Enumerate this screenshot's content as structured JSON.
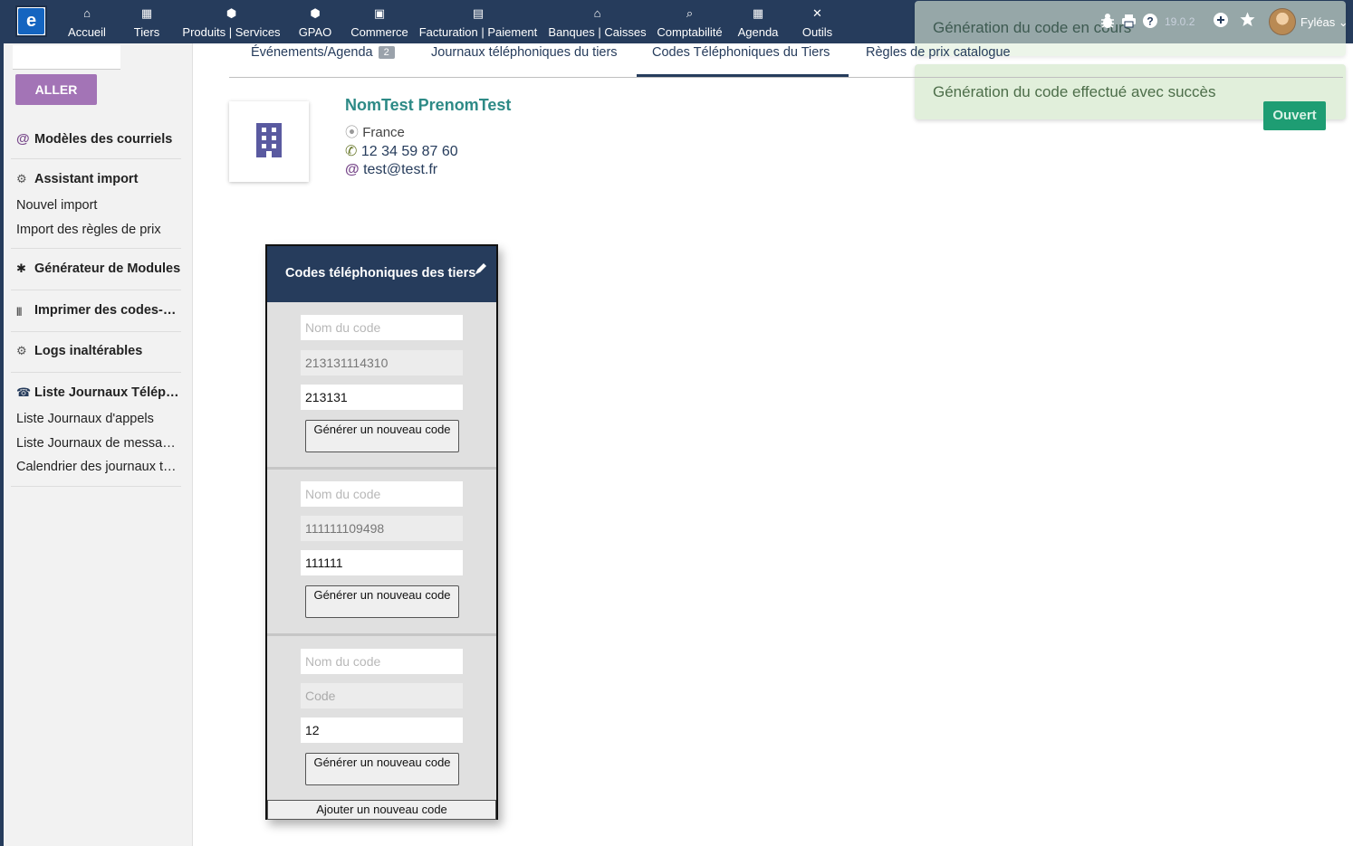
{
  "topbar": {
    "menu": [
      {
        "icon": "home-icon",
        "glyph": "⌂",
        "label": "Accueil"
      },
      {
        "icon": "building-icon",
        "glyph": "▦",
        "label": "Tiers"
      },
      {
        "icon": "cube-icon",
        "glyph": "⬢",
        "label": "Produits | Services"
      },
      {
        "icon": "cubes-icon",
        "glyph": "⬢",
        "label": "GPAO"
      },
      {
        "icon": "suitcase-icon",
        "glyph": "▣",
        "label": "Commerce"
      },
      {
        "icon": "file-invoice-icon",
        "glyph": "▤",
        "label": "Facturation | Paiement"
      },
      {
        "icon": "bank-icon",
        "glyph": "⌂",
        "label": "Banques | Caisses"
      },
      {
        "icon": "search-dollar-icon",
        "glyph": "⌕",
        "label": "Comptabilité"
      },
      {
        "icon": "calendar-icon",
        "glyph": "▦",
        "label": "Agenda"
      },
      {
        "icon": "tools-icon",
        "glyph": "✕",
        "label": "Outils"
      }
    ],
    "version": "19.0.2",
    "username": "Fyléas"
  },
  "sidebar": {
    "go_label": "ALLER",
    "sections": [
      {
        "title": "Modèles des courriels",
        "icon": "at-icon",
        "glyph": "@",
        "items": []
      },
      {
        "title": "Assistant import",
        "icon": "cogs-icon",
        "glyph": "⚙",
        "items": [
          "Nouvel import",
          "Import des règles de prix"
        ]
      },
      {
        "title": "Générateur de Modules",
        "icon": "bug-icon",
        "glyph": "✱",
        "items": []
      },
      {
        "title": "Imprimer des codes-barres",
        "icon": "barcode-icon",
        "glyph": "|||",
        "items": []
      },
      {
        "title": "Logs inaltérables",
        "icon": "cogs-icon",
        "glyph": "⚙",
        "items": []
      },
      {
        "title": "Liste Journaux Téléphoniques",
        "icon": "module-logo-icon",
        "glyph": "☎",
        "items": [
          "Liste Journaux d'appels",
          "Liste Journaux de messages",
          "Calendrier des journaux téléphoniques"
        ]
      }
    ]
  },
  "tabs": [
    {
      "label": "Événements/Agenda",
      "badge": "2"
    },
    {
      "label": "Journaux téléphoniques du tiers"
    },
    {
      "label": "Codes Téléphoniques du Tiers"
    },
    {
      "label": "Règles de prix catalogue"
    }
  ],
  "thirdparty": {
    "name": "NomTest PrenomTest",
    "country": "France",
    "phone": "12 34 59 87 60",
    "email": "test@test.fr",
    "open_label": "Ouvert"
  },
  "notifications": [
    "Génération du code en cours",
    "Génération du code effectué avec succès"
  ],
  "widget": {
    "title": "Codes téléphoniques des tiers",
    "name_placeholder": "Nom du code",
    "code_placeholder": "Code",
    "generate_label": "Générer un nouveau code",
    "add_label": "Ajouter un nouveau code",
    "codes": [
      {
        "name": "",
        "code": "213131114310",
        "prefix": "213131"
      },
      {
        "name": "",
        "code": "111111109498",
        "prefix": "111111"
      },
      {
        "name": "",
        "code": "",
        "prefix": "12"
      }
    ]
  },
  "colors": {
    "topbar": "#263c5c",
    "accent_purple": "#a374b6",
    "success_bg": "#e1efdb",
    "open_button": "#1e9d73",
    "name_link": "#2d8a86"
  }
}
